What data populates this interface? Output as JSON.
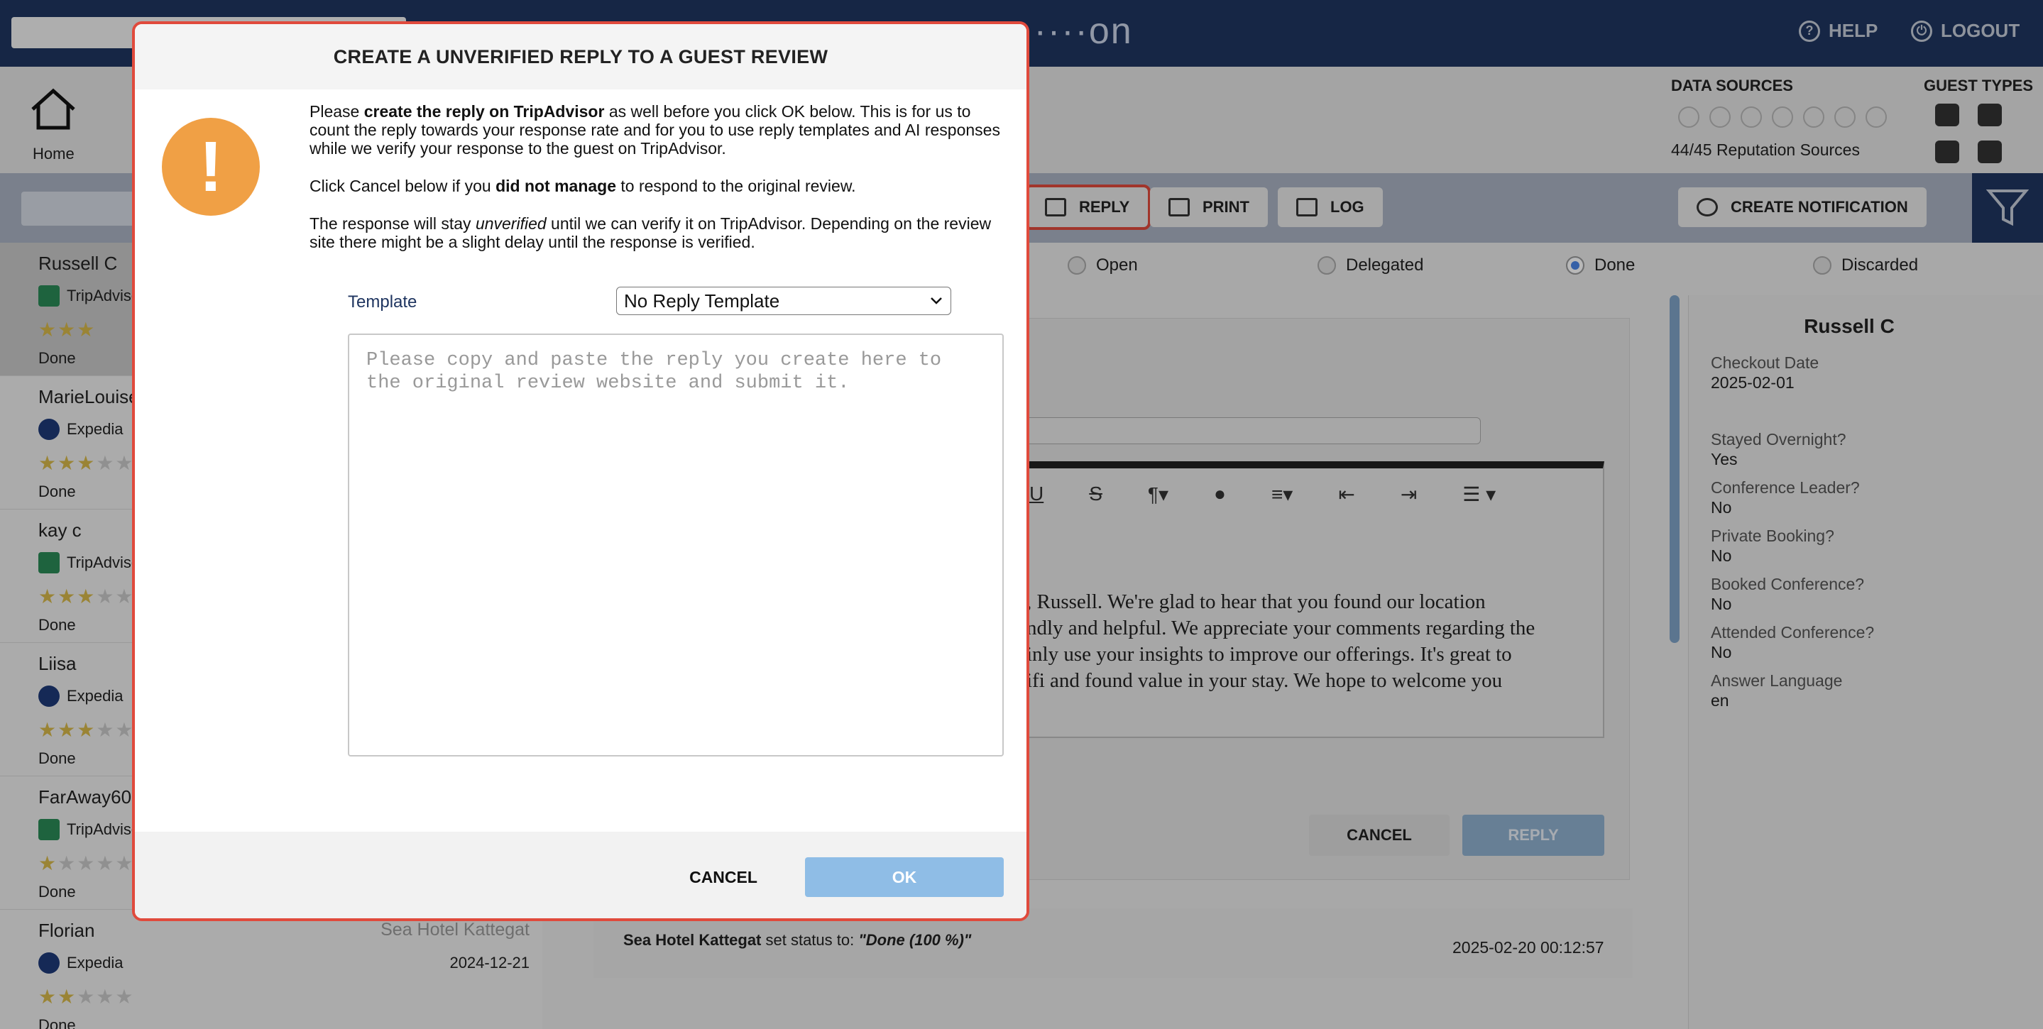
{
  "topbar": {
    "brand": "·········on",
    "help_label": "HELP",
    "logout_label": "LOGOUT"
  },
  "header": {
    "home_label": "Home",
    "data_sources_title": "DATA SOURCES",
    "guest_types_title": "GUEST TYPES",
    "reputation_count": "44/45 Reputation Sources"
  },
  "toolbar": {
    "reply_label": "REPLY",
    "print_label": "PRINT",
    "log_label": "LOG",
    "create_notification_label": "CREATE NOTIFICATION"
  },
  "status_filters": {
    "open": "Open",
    "delegated": "Delegated",
    "done": "Done",
    "discarded": "Discarded",
    "selected": "Done"
  },
  "reviews": [
    {
      "name": "Russell C",
      "source": "TripAdvisor",
      "stars": 3,
      "status": "Done",
      "hotel": "",
      "date": ""
    },
    {
      "name": "MarieLouise",
      "source": "Expedia",
      "stars": 3,
      "status": "Done",
      "hotel": "",
      "date": ""
    },
    {
      "name": "kay c",
      "source": "TripAdvisor",
      "stars": 3,
      "status": "Done",
      "hotel": "",
      "date": ""
    },
    {
      "name": "Liisa",
      "source": "Expedia",
      "stars": 3,
      "status": "Done",
      "hotel": "",
      "date": ""
    },
    {
      "name": "FarAway600",
      "source": "TripAdvisor",
      "stars": 1,
      "status": "Done",
      "hotel": "",
      "date": ""
    },
    {
      "name": "Florian",
      "source": "Expedia",
      "stars": 2,
      "status": "Done",
      "hotel": "Sea Hotel Kattegat",
      "date": "2024-12-21"
    }
  ],
  "editor": {
    "text": ", Russell. We're glad to hear that you found our location\nndly and helpful. We appreciate your comments regarding the\ninly use your insights to improve our offerings. It's great to\nifi and found value in your stay. We hope to welcome you",
    "cancel_label": "CANCEL",
    "reply_label": "REPLY"
  },
  "log": {
    "entry_actor": "Sea Hotel Kattegat",
    "entry_text": " set status to: ",
    "entry_status": "\"Done (100 %)\"",
    "entry_date": "2025-02-20 00:12:57"
  },
  "guest": {
    "name": "Russell C",
    "fields": [
      {
        "label": "Checkout Date",
        "value": "2025-02-01"
      },
      {
        "label": "Stayed Overnight?",
        "value": "Yes"
      },
      {
        "label": "Conference Leader?",
        "value": "No"
      },
      {
        "label": "Private Booking?",
        "value": "No"
      },
      {
        "label": "Booked Conference?",
        "value": "No"
      },
      {
        "label": "Attended Conference?",
        "value": "No"
      },
      {
        "label": "Answer Language",
        "value": "en"
      }
    ]
  },
  "modal": {
    "title": "CREATE A UNVERIFIED REPLY TO A GUEST REVIEW",
    "p1_a": "Please ",
    "p1_b": "create the reply on TripAdvisor",
    "p1_c": " as well before you click OK below. This is for us to count the reply towards your response rate and for you to use reply templates and AI responses while we verify your response to the guest on TripAdvisor.",
    "p2_a": "Click Cancel below if you ",
    "p2_b": "did not manage",
    "p2_c": " to respond to the original review.",
    "p3_a": "The response will stay ",
    "p3_b": "unverified",
    "p3_c": " until we can verify it on TripAdvisor. Depending on the review site there might be a slight delay until the response is verified.",
    "template_label": "Template",
    "template_selected": "No Reply Template",
    "textarea_placeholder": "Please copy and paste the reply you create here to the original review website and submit it.",
    "cancel_label": "CANCEL",
    "ok_label": "OK"
  }
}
